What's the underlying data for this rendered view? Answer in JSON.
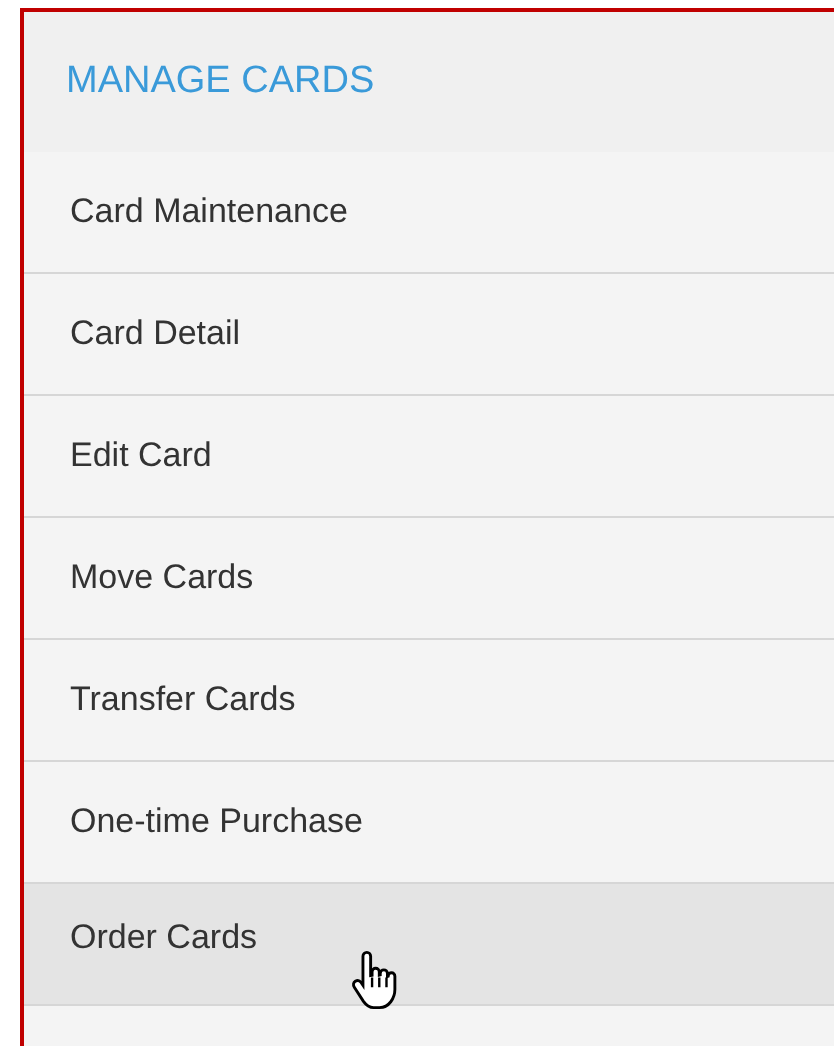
{
  "menu": {
    "title": "MANAGE CARDS",
    "items": [
      {
        "label": "Card Maintenance",
        "hovered": false
      },
      {
        "label": "Card Detail",
        "hovered": false
      },
      {
        "label": "Edit Card",
        "hovered": false
      },
      {
        "label": "Move Cards",
        "hovered": false
      },
      {
        "label": "Transfer Cards",
        "hovered": false
      },
      {
        "label": "One-time Purchase",
        "hovered": false
      },
      {
        "label": "Order Cards",
        "hovered": true
      }
    ]
  }
}
